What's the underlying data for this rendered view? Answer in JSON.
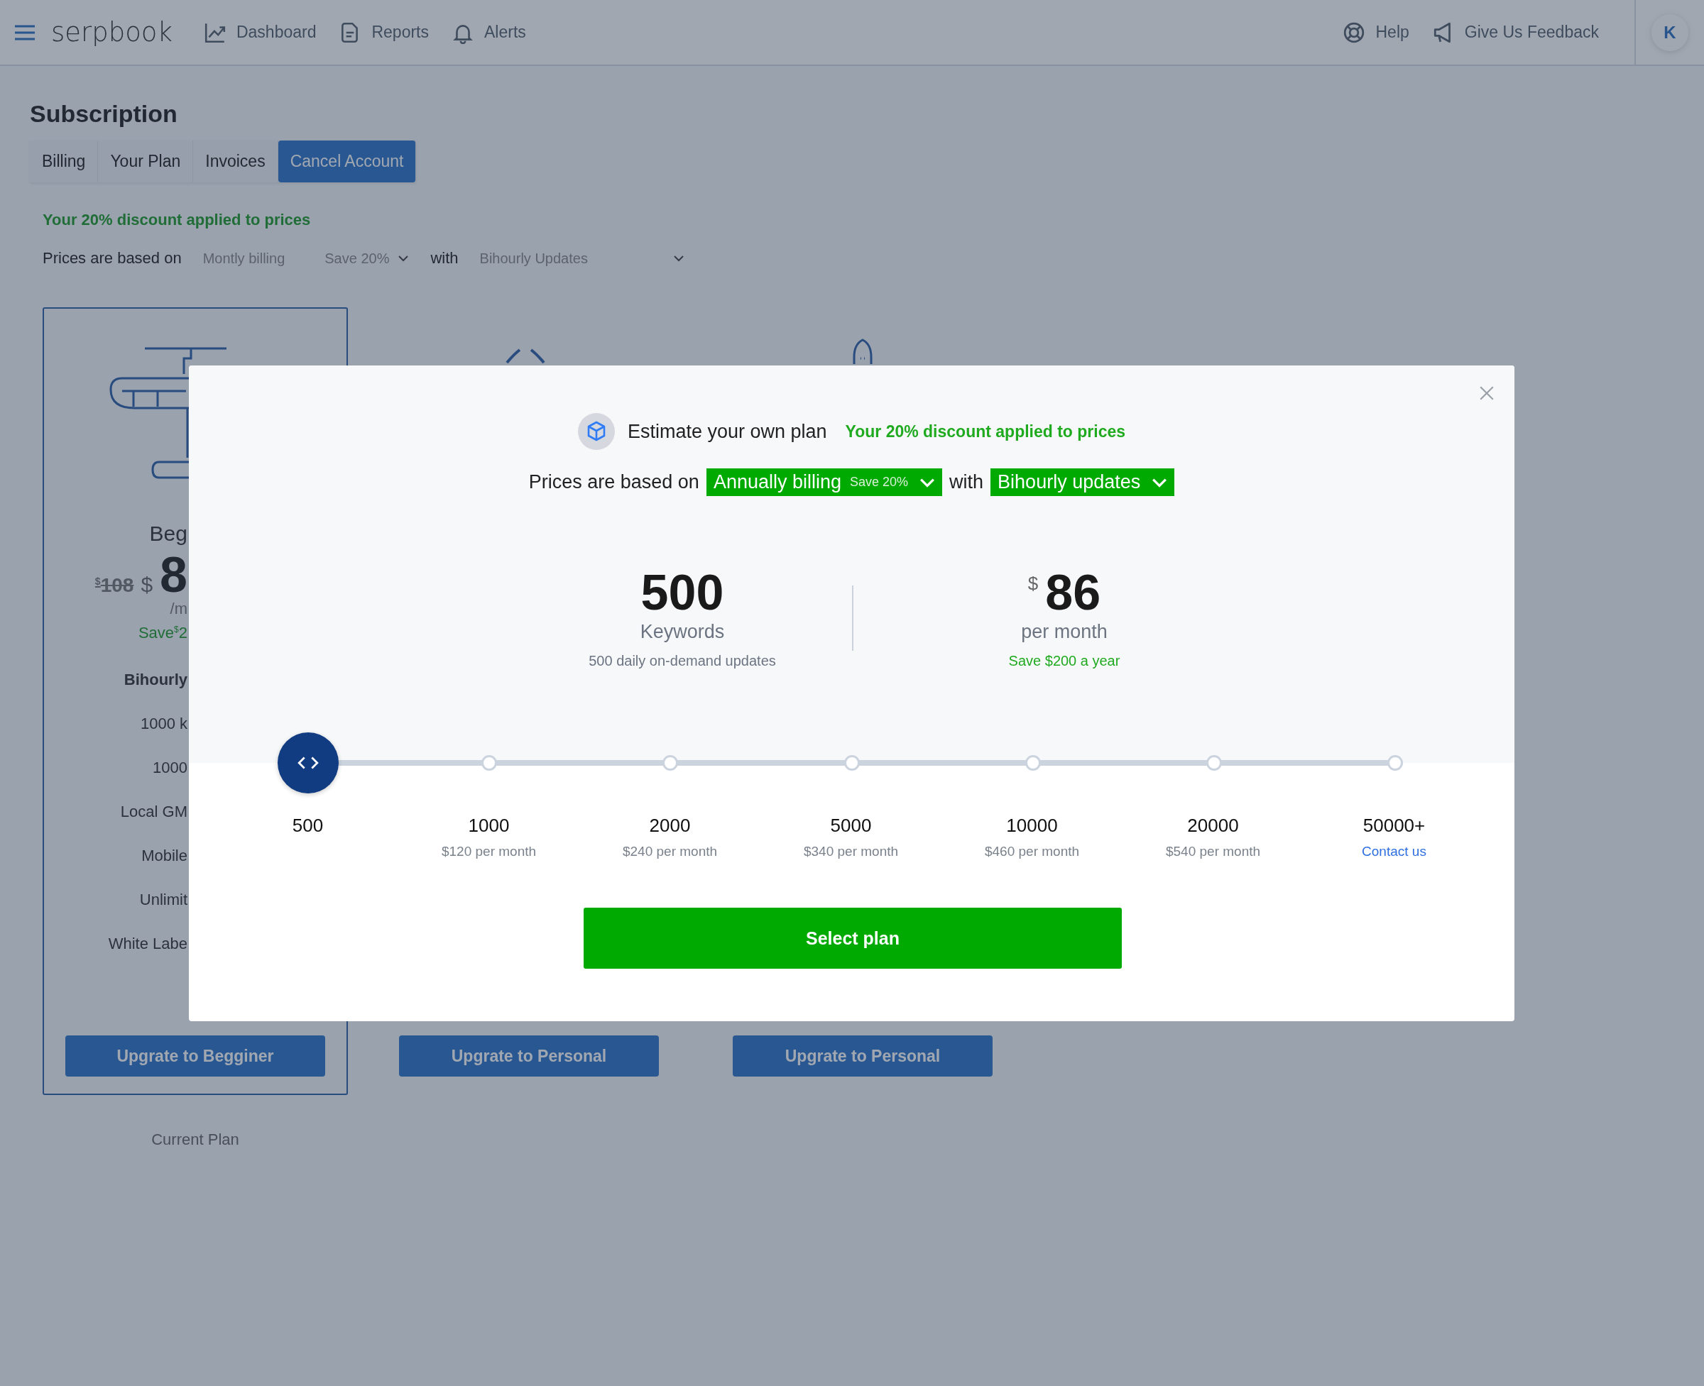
{
  "nav": {
    "brand": "serpbook",
    "links": [
      {
        "label": "Dashboard"
      },
      {
        "label": "Reports"
      },
      {
        "label": "Alerts"
      }
    ],
    "right_links": [
      {
        "label": "Help"
      },
      {
        "label": "Give Us Feedback"
      }
    ],
    "avatar": "K"
  },
  "page": {
    "title": "Subscription",
    "tabs": [
      {
        "label": "Billing",
        "selected": false
      },
      {
        "label": "Your Plan",
        "selected": false
      },
      {
        "label": "Invoices",
        "selected": false
      },
      {
        "label": "Cancel Account",
        "selected": true
      }
    ],
    "discount_note": "Your 20% discount applied to prices",
    "prices_row": {
      "prefix": "Prices are based on",
      "billing": "Montly billing",
      "billing_badge": "Save 20%",
      "connector": "with",
      "updates": "Bihourly Updates"
    }
  },
  "plans": [
    {
      "current": true,
      "name": "Beg",
      "old_currency": "$",
      "old_price": "108",
      "currency": "$",
      "price": "8",
      "period": "/m",
      "save_label": "Save",
      "save_currency": "$",
      "save_amount": "2",
      "features": [
        "Bihourly",
        "1000 k",
        "1000",
        "Local GM",
        "Mobile",
        "Unlimit",
        "White Labe"
      ],
      "button": "Upgrate to Begginer",
      "note": "Current Plan"
    },
    {
      "current": false,
      "button": "Upgrate to Personal"
    },
    {
      "current": false,
      "button": "Upgrate to Personal"
    }
  ],
  "modal": {
    "title": "Estimate your own plan",
    "discount_note": "Your 20% discount applied to prices",
    "prefix": "Prices are based on",
    "billing": "Annually billing",
    "billing_badge": "Save 20%",
    "connector": "with",
    "updates": "Bihourly updates",
    "keywords": {
      "value": "500",
      "label": "Keywords",
      "note": "500 daily on-demand updates"
    },
    "price": {
      "currency": "$",
      "value": "86",
      "label": "per month",
      "note": "Save $200 a year"
    },
    "stops": [
      {
        "value": "500",
        "selected": true
      },
      {
        "value": "1000",
        "price": "$120 per month",
        "selected": false
      },
      {
        "value": "2000",
        "price": "$240 per month",
        "selected": false
      },
      {
        "value": "5000",
        "price": "$340 per month",
        "selected": false
      },
      {
        "value": "10000",
        "price": "$460 per month",
        "selected": false
      },
      {
        "value": "20000",
        "price": "$540 per month",
        "selected": false
      },
      {
        "value": "50000+",
        "link": "Contact us",
        "selected": false
      }
    ],
    "button": "Select plan"
  }
}
